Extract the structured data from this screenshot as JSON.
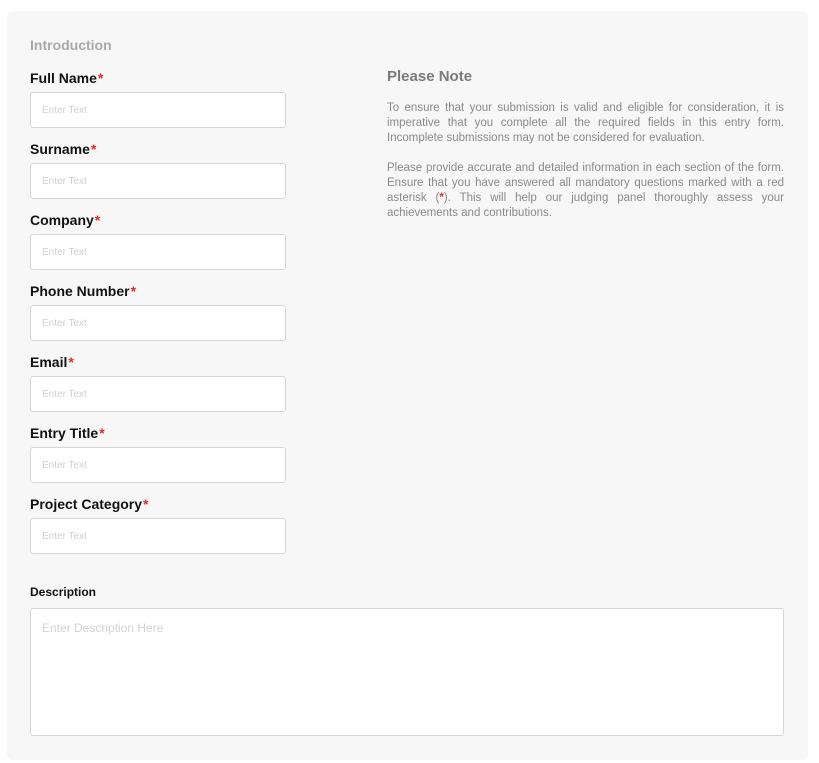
{
  "section": {
    "title": "Introduction"
  },
  "form": {
    "required_marker": "*",
    "fields": [
      {
        "label": "Full Name",
        "placeholder": "Enter Text",
        "value": ""
      },
      {
        "label": "Surname",
        "placeholder": "Enter Text",
        "value": ""
      },
      {
        "label": "Company",
        "placeholder": "Enter Text",
        "value": ""
      },
      {
        "label": "Phone Number",
        "placeholder": "Enter Text",
        "value": ""
      },
      {
        "label": "Email",
        "placeholder": "Enter Text",
        "value": ""
      },
      {
        "label": "Entry Title",
        "placeholder": "Enter Text",
        "value": ""
      },
      {
        "label": "Project Category",
        "placeholder": "Enter Text",
        "value": ""
      }
    ],
    "description": {
      "label": "Description",
      "placeholder": "Enter Description Here",
      "value": ""
    }
  },
  "note": {
    "title": "Please Note",
    "paragraph1": "To ensure that your submission is valid and eligible for consideration, it is imperative that you complete all the required fields in this entry form. Incomplete submissions may not be considered for evaluation.",
    "paragraph2_before": "Please provide accurate and detailed information in each section of the form. Ensure that you have answered all mandatory questions marked with a red asterisk (",
    "paragraph2_marker": "*",
    "paragraph2_after": "). This will help our judging panel thoroughly assess your achievements and contributions."
  },
  "colors": {
    "required": "#e02b2b",
    "card_background": "#f7f7f7",
    "input_border": "#d6d6d6"
  }
}
